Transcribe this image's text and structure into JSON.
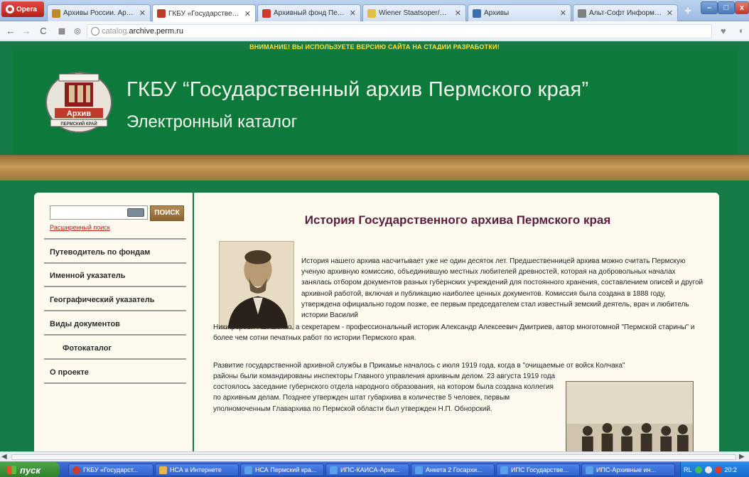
{
  "browser": {
    "app_label": "Opera",
    "tabs": [
      {
        "title": "Архивы России. Архивн",
        "favicon_color": "#c08a2a"
      },
      {
        "title": "ГКБУ «Государственный",
        "favicon_color": "#c0392b",
        "active": true
      },
      {
        "title": "Архивный фонд Пермск",
        "favicon_color": "#d13a2a"
      },
      {
        "title": "Wiener Staatsoper/Cultu",
        "favicon_color": "#e0c040"
      },
      {
        "title": "Архивы",
        "favicon_color": "#3a6fb0"
      },
      {
        "title": "Альт-Софт Информацио",
        "favicon_color": "#808080"
      }
    ],
    "tab_close_glyph": "✕",
    "new_tab_glyph": "+",
    "url_prefix": "catalog.",
    "url_domain": "archive.perm.ru",
    "window_controls": {
      "minimize": "–",
      "maximize": "□",
      "close": "x"
    }
  },
  "page": {
    "warning_text": "ВНИМАНИЕ! ВЫ ИСПОЛЬЗУЕТЕ ВЕРСИЮ САЙТА НА СТАДИИ РАЗРАБОТКИ!",
    "site_title": "ГКБУ “Государственный архив Пермского края”",
    "site_subtitle": "Электронный каталог",
    "logo_label": "Архив",
    "logo_caption": "ПЕРМСКИЙ КРАЙ",
    "colors": {
      "brand_green": "#157a45",
      "header_green": "#0d7a3c",
      "title_maroon": "#5b1e3a",
      "warning_yellow": "#ffe135",
      "gold": "#b3874a"
    }
  },
  "sidebar": {
    "search_button": "ПОИСК",
    "advanced_search": "Расширенный поиск",
    "items": [
      {
        "label": "Путеводитель по фондам"
      },
      {
        "label": "Именной указатель"
      },
      {
        "label": "Географический указатель"
      },
      {
        "label": "Виды документов"
      },
      {
        "label": "Фотокаталог",
        "sub": true
      },
      {
        "label": "О проекте"
      }
    ]
  },
  "article": {
    "title": "История Государственного архива Пермского края",
    "p1": "История нашего архива насчитывает уже не один десяток лет. Предшественницей архива можно считать Пермскую ученую архивную комиссию, объединившую местных любителей древностей, которая на добровольных началах занялась отбором документов разных губернских учреждений для постоянного хранения, составлением описей и другой архивной работой, включая и публикацию наиболее ценных документов. Комиссия была создана в 1888 году, утверждена официально годом позже, ее первым председателем стал известный земский деятель, врач и любитель истории Василий",
    "p2": "Никифорович Шишонко, а секретарем - профессиональный историк Александр Алексеевич Дмитриев, автор многотомной \"Пермской старины\" и более чем сотни печатных работ по истории Пермского края.",
    "p3": "Развитие государственной архивной службы в Прикамье началось с июля 1919 года, когда в \"очищаемые от войск Колчака\"",
    "p4": "районы были командированы инспекторы Главного управления архивным делом. 23 августа 1919 года состоялось заседание губернского отдела народного образования, на котором была создана коллегия по архивным делам. Позднее утвержден штат губархива в количестве 5 человек, первым уполномоченным Главархива по Пермской области был утвержден Н.П. Обнорский."
  },
  "taskbar": {
    "start_label": "пуск",
    "items": [
      {
        "label": "ГКБУ «Государст..."
      },
      {
        "label": "НСА в Интернете"
      },
      {
        "label": "НСА Пермский кра..."
      },
      {
        "label": "ИПС-КАИСА-Архи..."
      },
      {
        "label": "Анкета 2 Госархи..."
      },
      {
        "label": "ИПС Государстве..."
      },
      {
        "label": "ИПС-Архивные ин..."
      }
    ],
    "tray_lang": "RL",
    "tray_time": "20:2"
  }
}
